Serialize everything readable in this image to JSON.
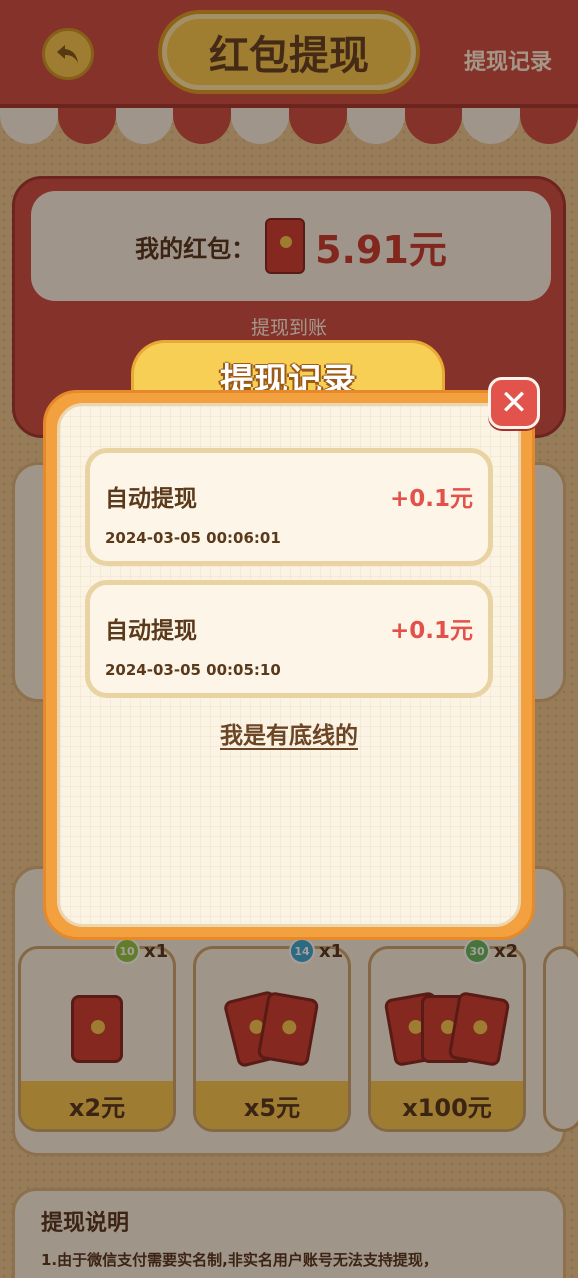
{
  "header": {
    "title": "红包提现",
    "record_link": "提现记录",
    "back_icon": "back-arrow-icon"
  },
  "wallet": {
    "label": "我的红包：",
    "amount": "5.91元",
    "subtitle": "提现到账"
  },
  "shop": {
    "items": [
      {
        "badge_count": "10",
        "multiplier": "x1",
        "price": "x2元",
        "badge_color": "#8cc63f"
      },
      {
        "badge_count": "14",
        "multiplier": "x1",
        "price": "x5元",
        "badge_color": "#2fa4d6"
      },
      {
        "badge_count": "30",
        "multiplier": "x2",
        "price": "x100元",
        "badge_color": "#5cb85c"
      }
    ]
  },
  "explanation": {
    "title": "提现说明",
    "text": "1.由于微信支付需要实名制,非实名用户账号无法支持提现，"
  },
  "modal": {
    "title": "提现记录",
    "close_icon": "close-icon",
    "records": [
      {
        "type": "自动提现",
        "amount": "+0.1元",
        "time": "2024-03-05 00:06:01"
      },
      {
        "type": "自动提现",
        "amount": "+0.1元",
        "time": "2024-03-05 00:05:10"
      }
    ],
    "bottom_link": "我是有底线的"
  },
  "colors": {
    "primary_red": "#c9473f",
    "gold": "#f3c44a",
    "modal_orange": "#f3a03e",
    "amount_red": "#e2524a",
    "text_brown": "#5b3a1c"
  }
}
